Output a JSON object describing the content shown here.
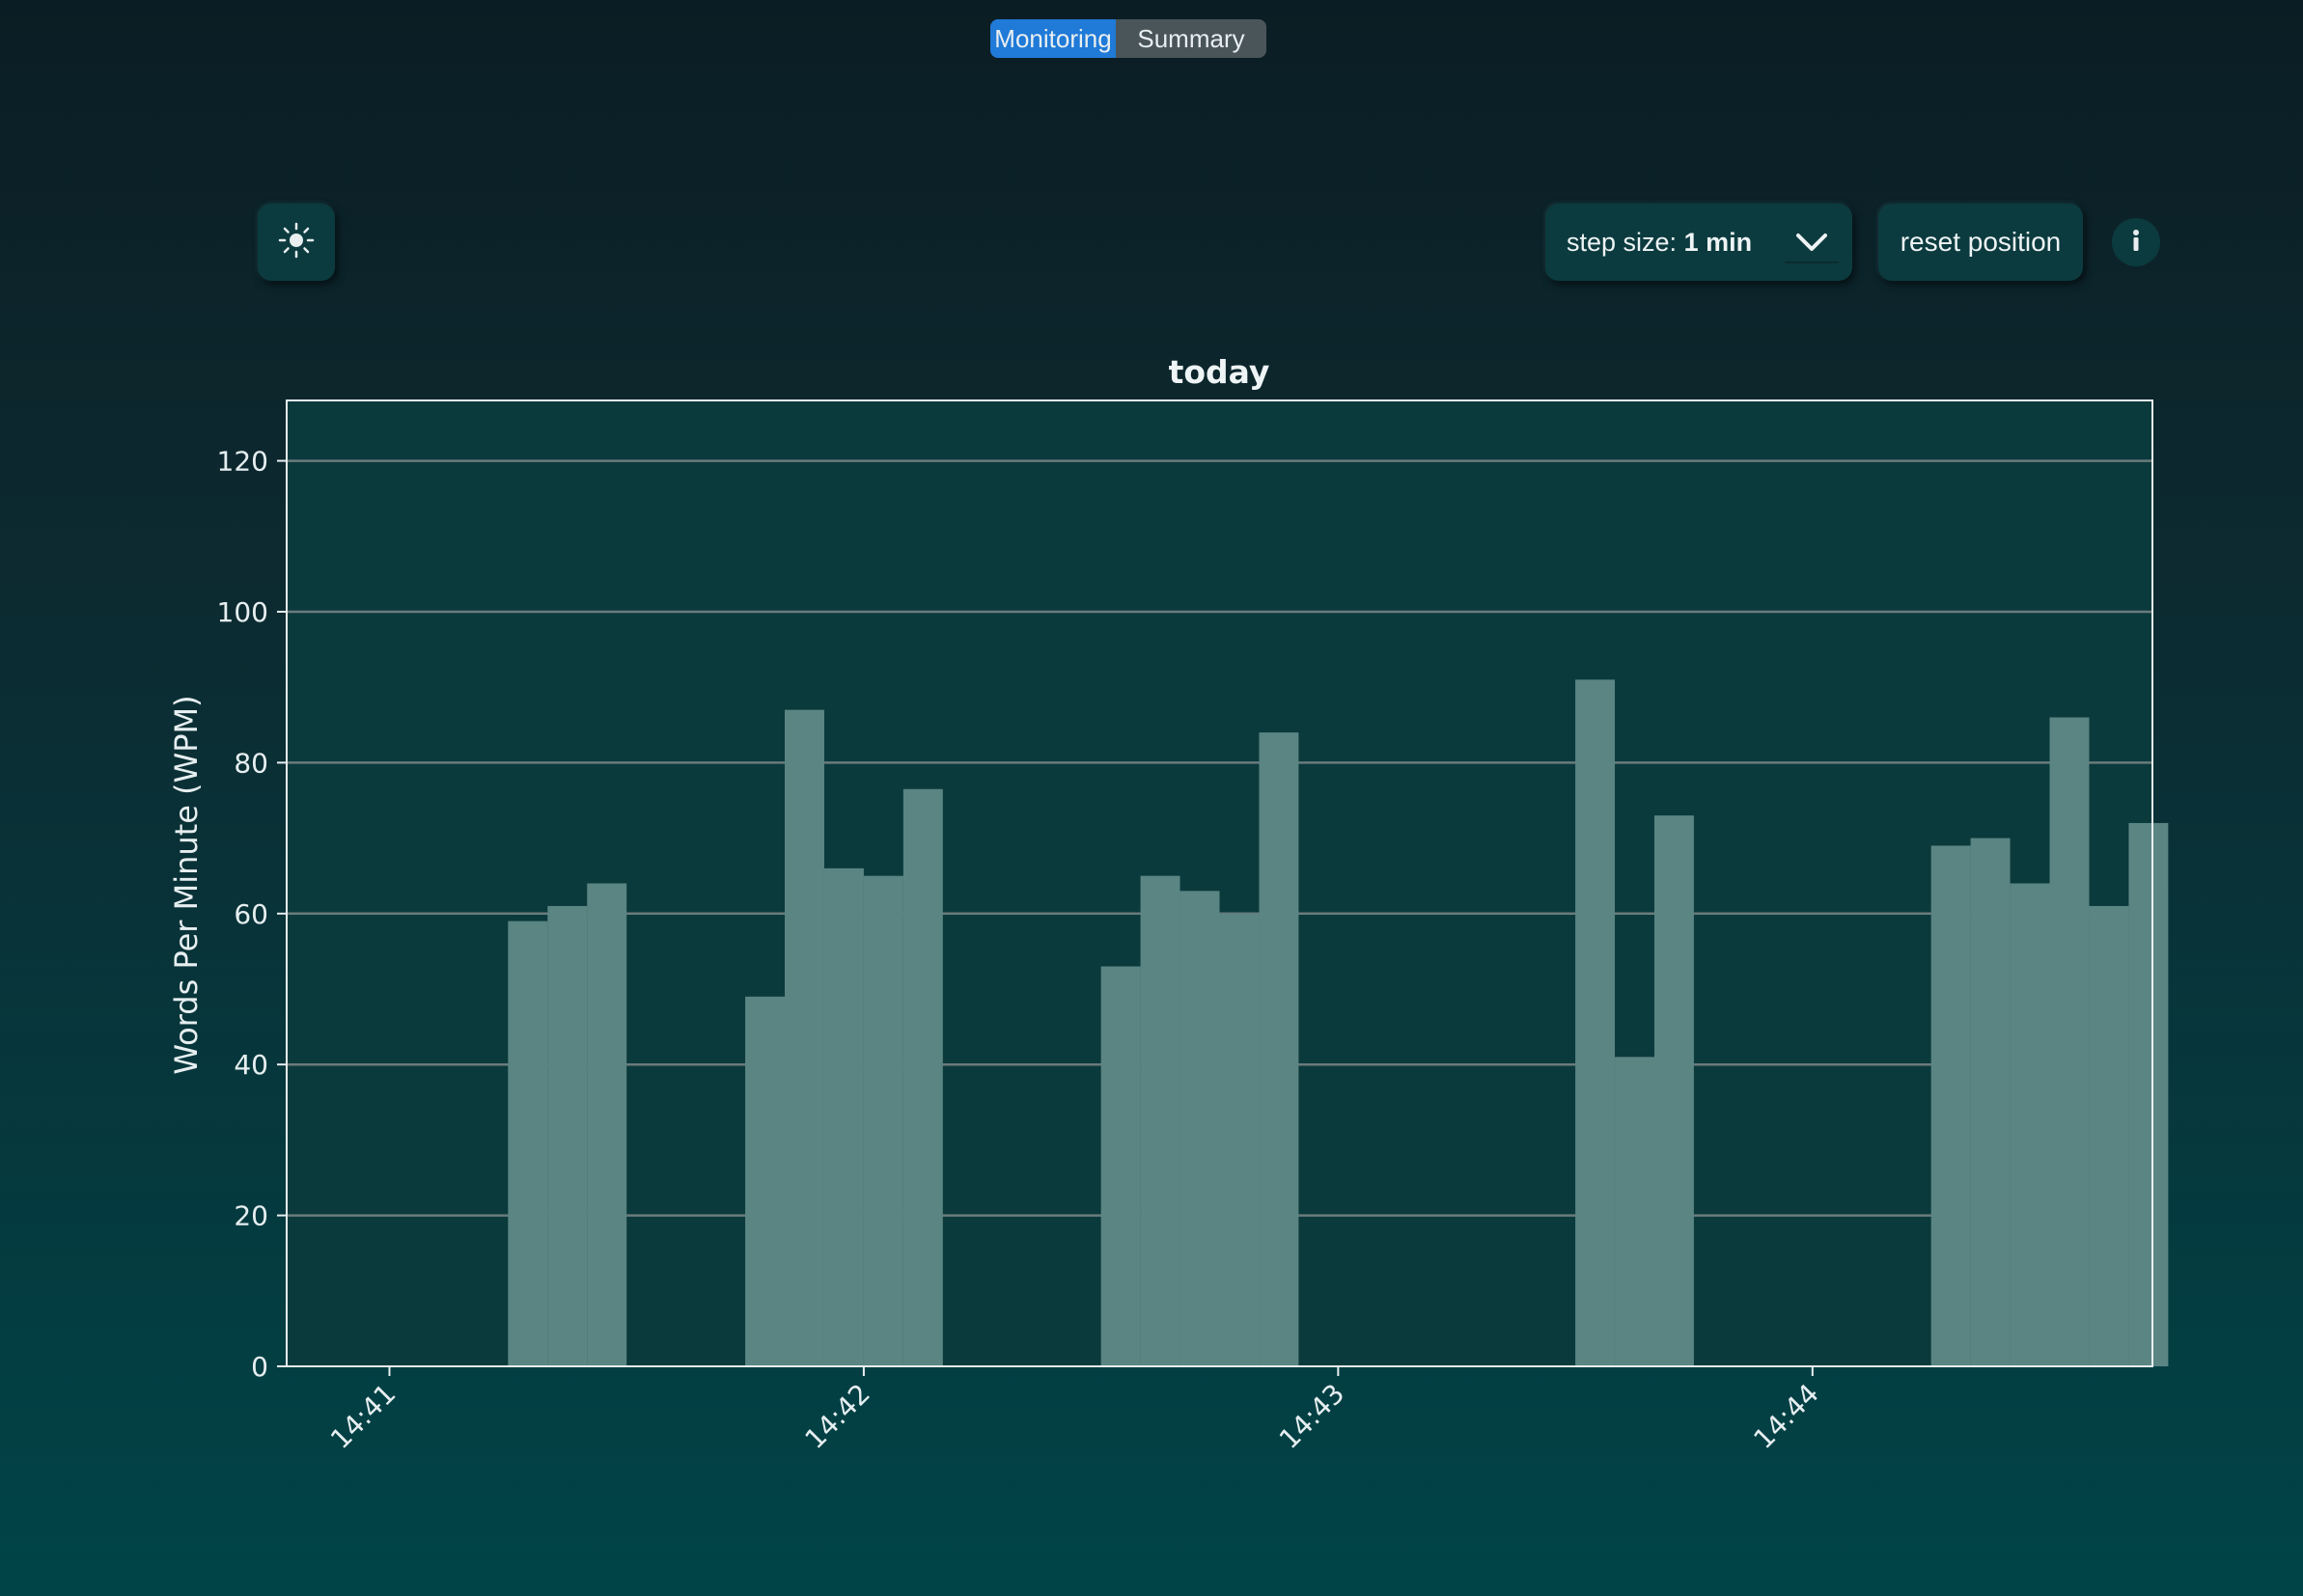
{
  "tabs": [
    {
      "label": "Monitoring",
      "active": true
    },
    {
      "label": "Summary",
      "active": false
    }
  ],
  "toolbar": {
    "theme_icon": "sun-icon",
    "step_prefix": "step size: ",
    "step_value": "1 min",
    "step_icon": "chevron-down-icon",
    "reset_label": "reset position",
    "info_icon": "info-icon"
  },
  "colors": {
    "active_tab": "#1f7ad8",
    "bar": "#5a8583",
    "plot_bg": "#0b3a3d"
  },
  "chart_data": {
    "type": "bar",
    "title": "today",
    "xlabel": "",
    "ylabel": "Words Per Minute (WPM)",
    "ylim": [
      0,
      128
    ],
    "yticks": [
      0,
      20,
      40,
      60,
      80,
      100,
      120
    ],
    "xlim": [
      "14:40:47",
      "14:44:43"
    ],
    "xticks": [
      "14:41",
      "14:42",
      "14:43",
      "14:44"
    ],
    "grid": "horizontal",
    "bar_width_seconds": 5,
    "bars": [
      {
        "t": "14:41:15",
        "wpm": 59
      },
      {
        "t": "14:41:20",
        "wpm": 61
      },
      {
        "t": "14:41:25",
        "wpm": 64
      },
      {
        "t": "14:41:45",
        "wpm": 49
      },
      {
        "t": "14:41:50",
        "wpm": 87
      },
      {
        "t": "14:41:55",
        "wpm": 66
      },
      {
        "t": "14:42:00",
        "wpm": 65
      },
      {
        "t": "14:42:05",
        "wpm": 76.5
      },
      {
        "t": "14:42:30",
        "wpm": 53
      },
      {
        "t": "14:42:35",
        "wpm": 65
      },
      {
        "t": "14:42:40",
        "wpm": 63
      },
      {
        "t": "14:42:45",
        "wpm": 60
      },
      {
        "t": "14:42:50",
        "wpm": 84
      },
      {
        "t": "14:43:30",
        "wpm": 91
      },
      {
        "t": "14:43:35",
        "wpm": 41
      },
      {
        "t": "14:43:40",
        "wpm": 73
      },
      {
        "t": "14:44:15",
        "wpm": 69
      },
      {
        "t": "14:44:20",
        "wpm": 70
      },
      {
        "t": "14:44:25",
        "wpm": 64
      },
      {
        "t": "14:44:30",
        "wpm": 86
      },
      {
        "t": "14:44:35",
        "wpm": 61
      },
      {
        "t": "14:44:40",
        "wpm": 72
      }
    ]
  }
}
